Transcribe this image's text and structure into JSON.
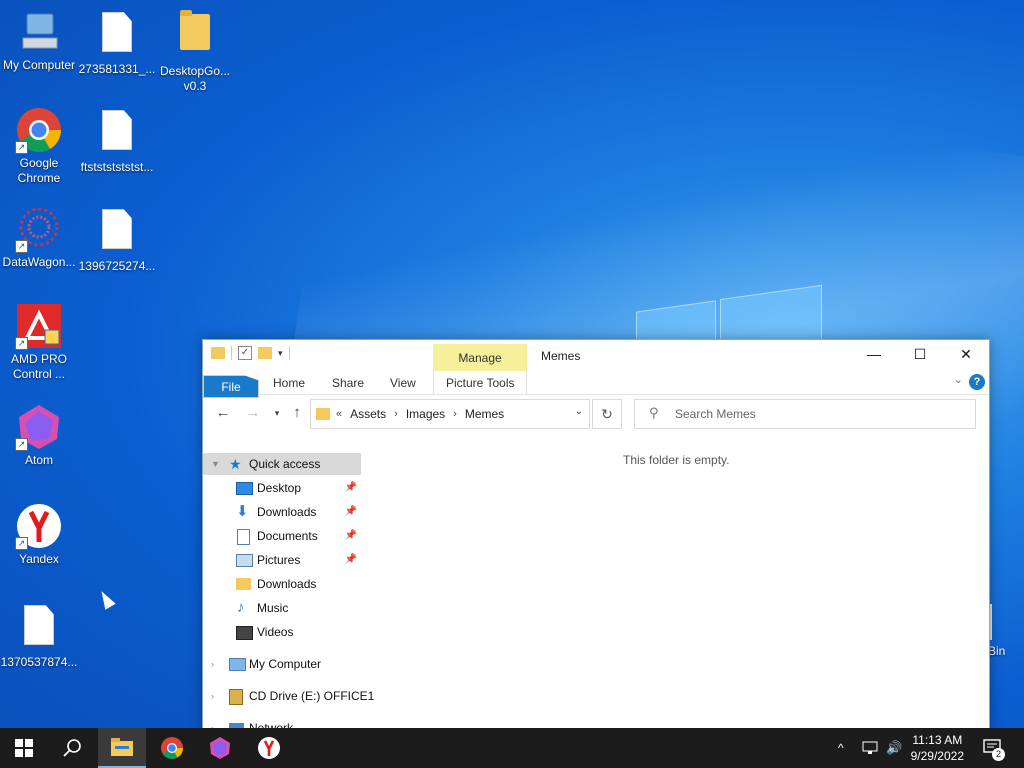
{
  "desktop": {
    "icons": [
      {
        "label": "My Computer"
      },
      {
        "label": "273581331_..."
      },
      {
        "label": "DesktopGo... v0.3"
      },
      {
        "label": "Google Chrome"
      },
      {
        "label": "ftstststststst..."
      },
      {
        "label": "DataWagon..."
      },
      {
        "label": "1396725274..."
      },
      {
        "label": "AMD PRO Control ..."
      },
      {
        "label": "Atom"
      },
      {
        "label": "Yandex"
      },
      {
        "label": "1370537874..."
      }
    ],
    "recycle_bin_label": "Bin"
  },
  "explorer": {
    "title": "Memes",
    "contextual_tab": "Manage",
    "ribbon_tabs": [
      "File",
      "Home",
      "Share",
      "View",
      "Picture Tools"
    ],
    "address": {
      "prefix": "«",
      "crumbs": [
        "Assets",
        "Images",
        "Memes"
      ]
    },
    "search_placeholder": "Search Memes",
    "empty_message": "This folder is empty.",
    "nav": {
      "quick_access": "Quick access",
      "items": [
        {
          "label": "Desktop",
          "pinned": true,
          "icon": "desktop-icon"
        },
        {
          "label": "Downloads",
          "pinned": true,
          "icon": "downloads-icon"
        },
        {
          "label": "Documents",
          "pinned": true,
          "icon": "documents-icon"
        },
        {
          "label": "Pictures",
          "pinned": true,
          "icon": "pictures-icon"
        },
        {
          "label": "Downloads",
          "pinned": false,
          "icon": "folder-icon"
        },
        {
          "label": "Music",
          "pinned": false,
          "icon": "music-icon"
        },
        {
          "label": "Videos",
          "pinned": false,
          "icon": "videos-icon"
        }
      ],
      "my_computer": "My Computer",
      "cd_drive": "CD Drive (E:) OFFICE1",
      "network": "Network"
    }
  },
  "taskbar": {
    "time": "11:13 AM",
    "date": "9/29/2022",
    "notification_count": "2",
    "accent": "#1979ca"
  }
}
